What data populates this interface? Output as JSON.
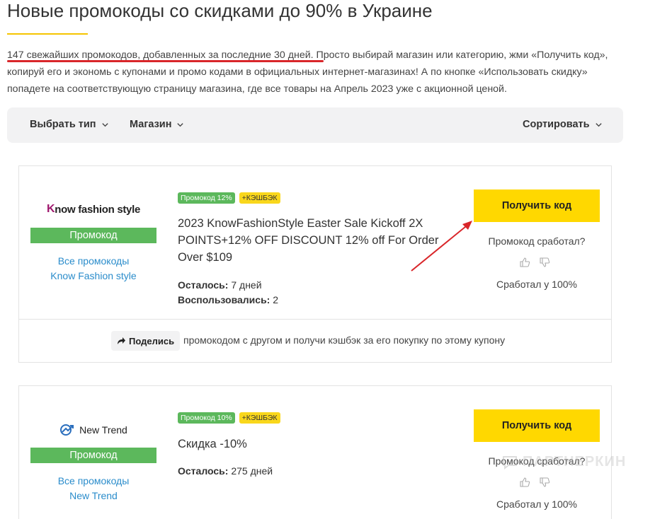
{
  "page": {
    "title": "Новые промокоды со скидками до 90% в Украине",
    "intro_highlight": "147 свежайших промокодов, добавленных за последние 30 дней",
    "intro_rest": ". Просто выбирай магазин или категорию, жми «Получить код», копируй его и экономь с купонами и промо кодами в официальных интернет-магазинах! А по кнопке «Использовать скидку» попадете на соответствующую страницу магазина, где все товары на Апрель 2023 уже с акционной ценой."
  },
  "filters": {
    "type_label": "Выбрать тип",
    "shop_label": "Магазин",
    "sort_label": "Сортировать"
  },
  "coupons": [
    {
      "logo_k": "K",
      "logo_text": "now fashion style",
      "label": "Промокод",
      "all_promos_line1": "Все промокоды",
      "all_promos_line2": "Know Fashion style",
      "badge_promo": "Промокод 12%",
      "badge_cashback": "+КЭШБЭК",
      "title": "2023 KnowFashionStyle Easter Sale Kickoff 2X POINTS+12% OFF DISCOUNT 12% off For Order Over $109",
      "remaining_label": "Осталось:",
      "remaining_value": "7 дней",
      "used_label": "Воспользовались:",
      "used_value": "2",
      "button": "Получить код",
      "worked_question": "Промокод сработал?",
      "worked_pct": "Сработал у 100%",
      "share_button": "Поделись",
      "share_text": "промокодом с другом и получи кэшбэк за его покупку по этому купону"
    },
    {
      "logo_text": "New Trend",
      "label": "Промокод",
      "all_promos_line1": "Все промокоды",
      "all_promos_line2": "New Trend",
      "badge_promo": "Промокод 10%",
      "badge_cashback": "+КЭШБЭК",
      "title": "Скидка -10%",
      "remaining_label": "Осталось:",
      "remaining_value": "275 дней",
      "button": "Получить код",
      "worked_question": "Промокод сработал?",
      "worked_pct": "Сработал у 100%"
    }
  ],
  "watermark": "ПАРТНЕРКИН",
  "colors": {
    "accent_yellow": "#ffd800",
    "promo_green": "#5cb85c",
    "link_blue": "#2a8ccb",
    "annotation_red": "#d9262a"
  }
}
